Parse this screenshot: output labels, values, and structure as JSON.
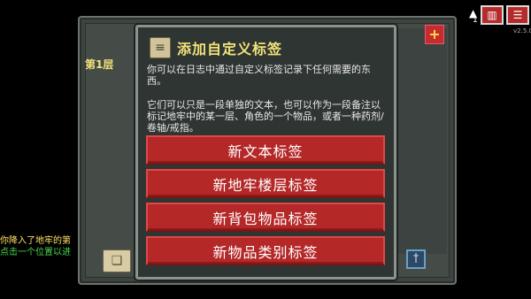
{
  "journal": {
    "floor_label": "第1层"
  },
  "dialog": {
    "title": "添加自定义标签",
    "icon": "scroll-icon",
    "paragraph1": "你可以在日志中通过自定义标签记录下任何需要的东西。",
    "paragraph2": "它们可以只是一段单独的文本，也可以作为一段备注以标记地牢中的某一层、角色的一个物品，或者一种药剂/卷轴/戒指。",
    "buttons": [
      {
        "label": "新文本标签"
      },
      {
        "label": "新地牢楼层标签"
      },
      {
        "label": "新背包物品标签"
      },
      {
        "label": "新物品类别标签"
      }
    ]
  },
  "hud": {
    "level_num": "1",
    "version": "v2.5.0",
    "plus_icon": "plus-icon",
    "journal_icon": "book-icon",
    "menu_icon": "menu-icon"
  },
  "log": {
    "line1": "你降入了地牢的第",
    "line2": "点击一个位置以进"
  },
  "colors": {
    "button_red": "#b42828",
    "title_yellow": "#f2e27a",
    "log_green": "#49d949",
    "log_yellow": "#ffe066"
  }
}
